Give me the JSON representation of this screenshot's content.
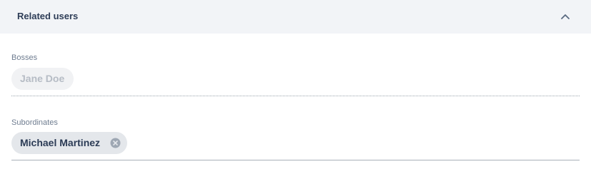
{
  "panel": {
    "title": "Related users",
    "collapse_icon": "chevron-up-icon"
  },
  "fields": {
    "bosses": {
      "label": "Bosses",
      "chips": [
        {
          "name": "Jane Doe",
          "state": "disabled"
        }
      ]
    },
    "subordinates": {
      "label": "Subordinates",
      "chips": [
        {
          "name": "Michael Martinez",
          "state": "removable",
          "remove_icon": "close-circle-icon"
        }
      ]
    }
  },
  "colors": {
    "header_bg": "#f2f4f7",
    "title_text": "#2e3d57",
    "label_text": "#6f7d90",
    "chip_active_bg": "#e4e7eb",
    "chip_disabled_bg": "#f1f2f4",
    "chip_disabled_text": "#b6bcc5"
  }
}
